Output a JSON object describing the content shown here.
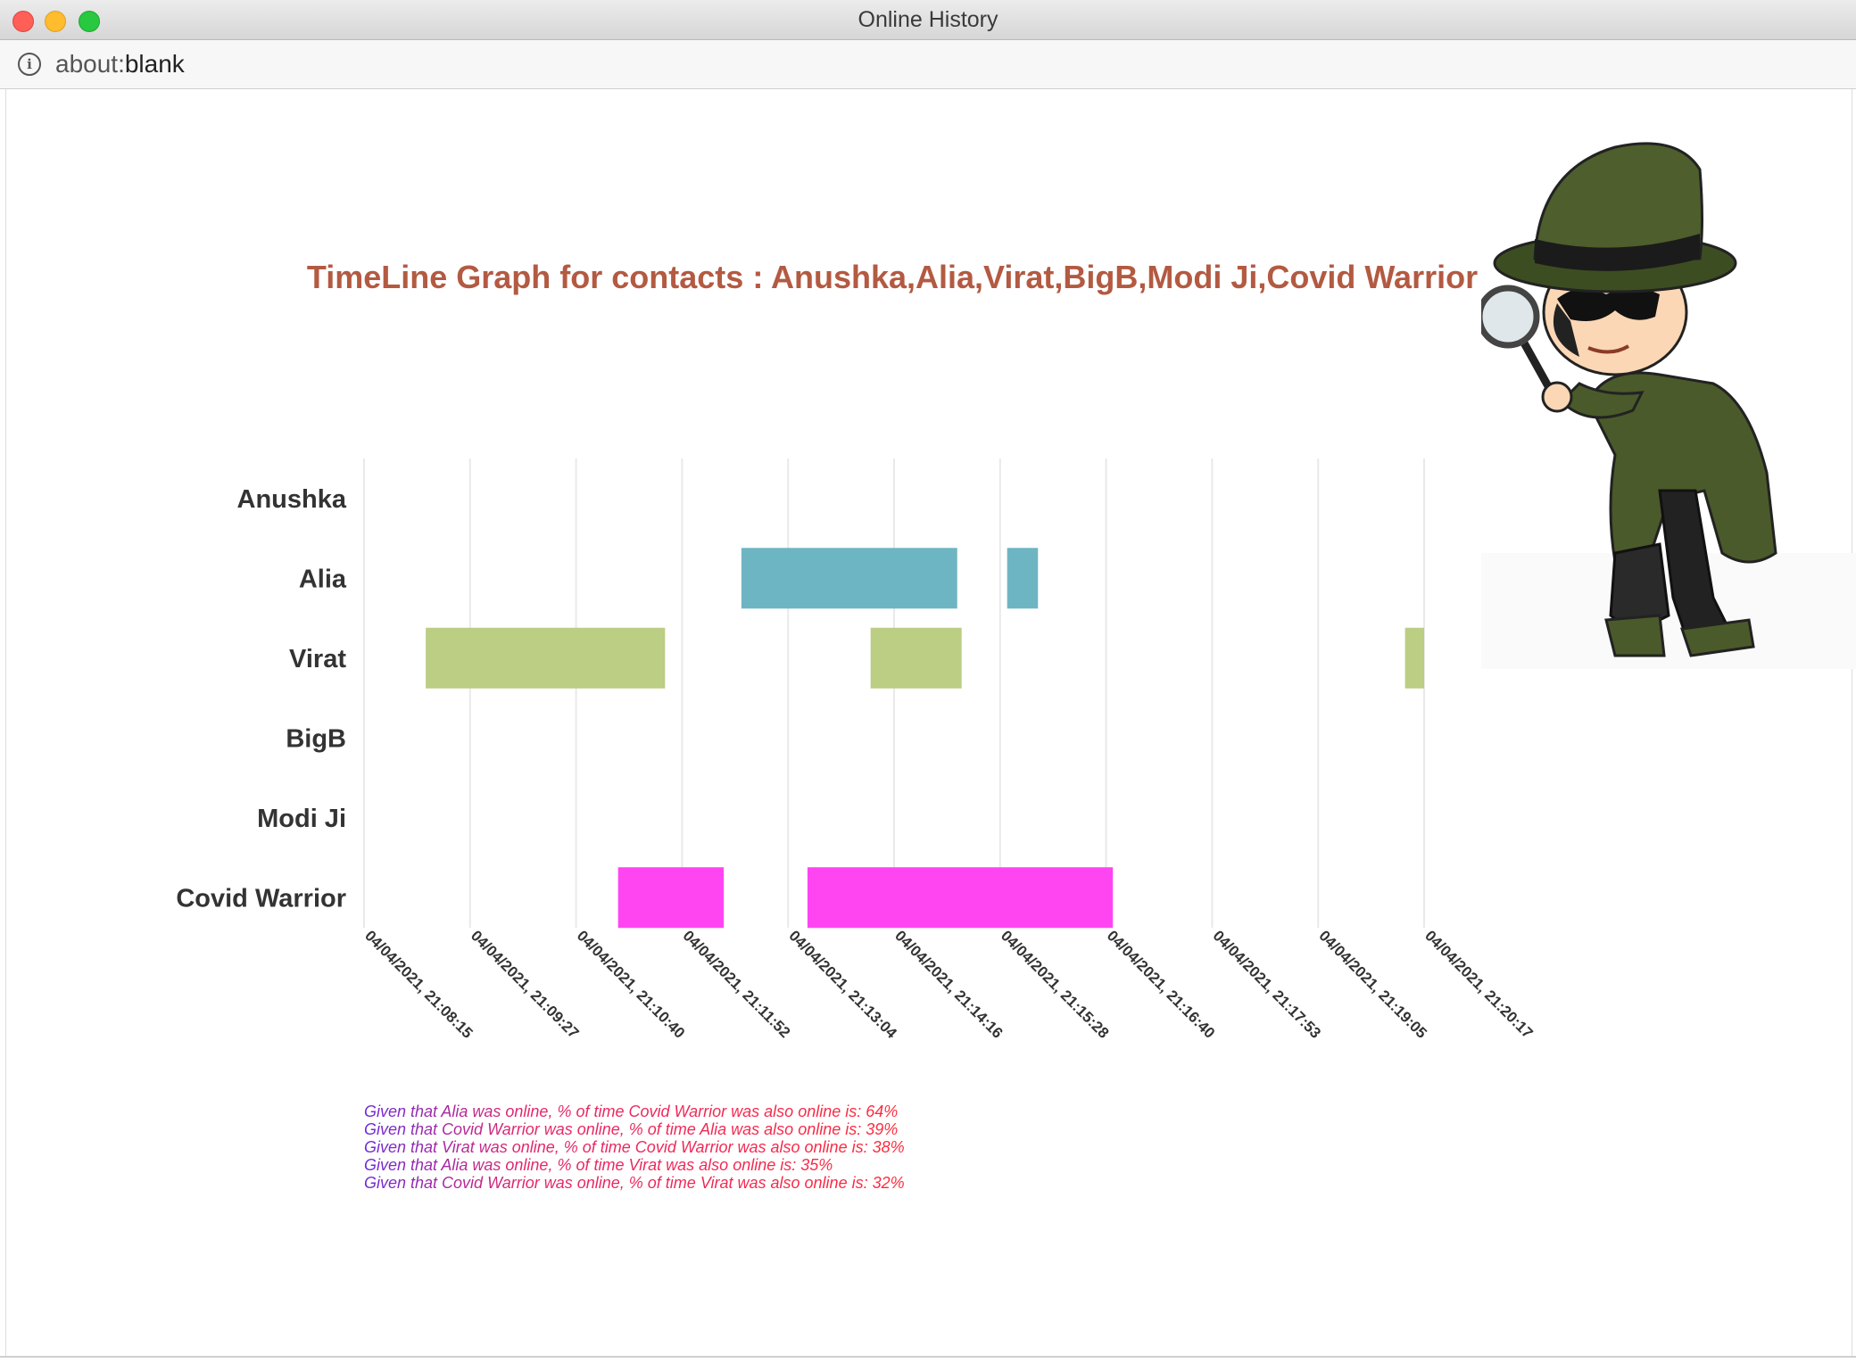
{
  "window": {
    "title": "Online History"
  },
  "addressbar": {
    "scheme": "about:",
    "rest": "blank"
  },
  "chart_data": {
    "type": "timeline",
    "title": "TimeLine Graph for contacts : Anushka,Alia,Virat,BigB,Modi Ji,Covid Warrior",
    "rows": [
      "Anushka",
      "Alia",
      "Virat",
      "BigB",
      "Modi Ji",
      "Covid Warrior"
    ],
    "x_ticks": [
      "04/04/2021, 21:08:15",
      "04/04/2021, 21:09:27",
      "04/04/2021, 21:10:40",
      "04/04/2021, 21:11:52",
      "04/04/2021, 21:13:04",
      "04/04/2021, 21:14:16",
      "04/04/2021, 21:15:28",
      "04/04/2021, 21:16:40",
      "04/04/2021, 21:17:53",
      "04/04/2021, 21:19:05",
      "04/04/2021, 21:20:17"
    ],
    "xlim": [
      "21:08:15",
      "21:20:17"
    ],
    "grid": true,
    "bars": [
      {
        "row": "Alia",
        "start": "21:12:32",
        "end": "21:14:59",
        "color": "#6eb5c4"
      },
      {
        "row": "Alia",
        "start": "21:15:33",
        "end": "21:15:54",
        "color": "#6eb5c4"
      },
      {
        "row": "Virat",
        "start": "21:08:57",
        "end": "21:11:40",
        "color": "#bccd84"
      },
      {
        "row": "Virat",
        "start": "21:14:00",
        "end": "21:15:02",
        "color": "#bccd84"
      },
      {
        "row": "Virat",
        "start": "21:20:04",
        "end": "21:20:17",
        "color": "#bccd84"
      },
      {
        "row": "Covid Warrior",
        "start": "21:11:08",
        "end": "21:12:20",
        "color": "#ff44f2"
      },
      {
        "row": "Covid Warrior",
        "start": "21:13:17",
        "end": "21:16:45",
        "color": "#ff44f2"
      }
    ]
  },
  "stats": [
    "Given that Alia was online, % of time Covid Warrior was also online is: 64%",
    "Given that Covid Warrior was online, % of time Alia was also online is: 39%",
    "Given that Virat was online, % of time Covid Warrior was also online is: 38%",
    "Given that Alia was online, % of time Virat was also online is: 35%",
    "Given that Covid Warrior was online, % of time Virat was also online is: 32%"
  ],
  "colors": {
    "title": "#b35a42",
    "grid": "#e9e9e9",
    "label": "#333333"
  }
}
